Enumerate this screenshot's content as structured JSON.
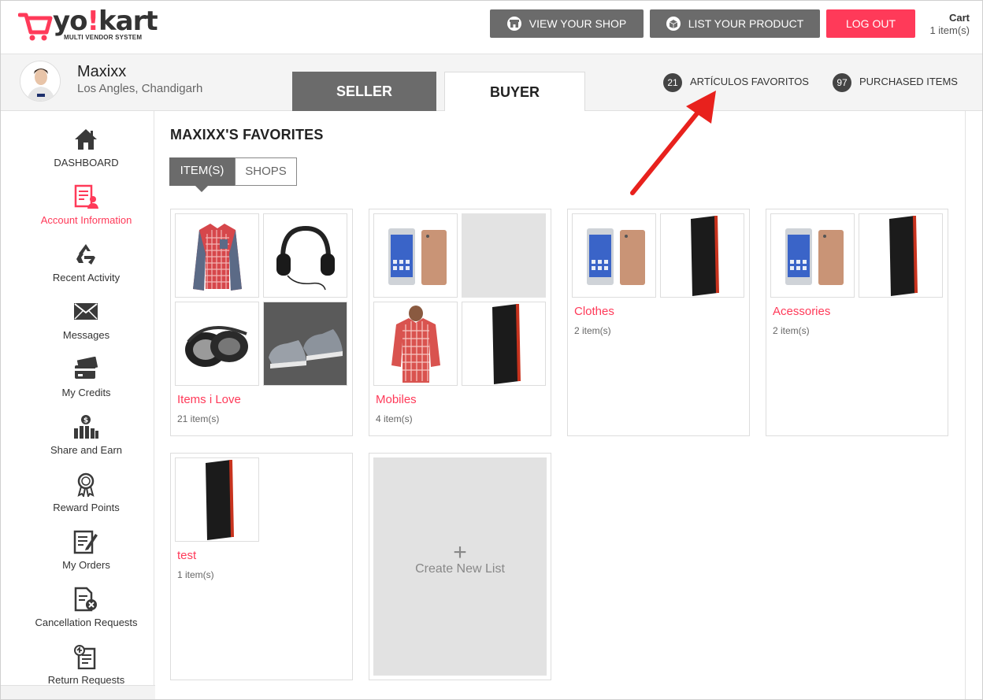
{
  "header": {
    "logo_main": "yo",
    "logo_mark": "!",
    "logo_end": "kart",
    "logo_sub": "MULTI VENDOR SYSTEM",
    "view_shop": "VIEW YOUR SHOP",
    "list_product": "LIST YOUR PRODUCT",
    "logout": "LOG OUT",
    "cart_title": "Cart",
    "cart_count": "1 item(s)"
  },
  "profile": {
    "name": "Maxixx",
    "location": "Los Angles, Chandigarh",
    "tabs": [
      "SELLER",
      "BUYER"
    ],
    "fav_count": "21",
    "fav_label": "ARTÍCULOS FAVORITOS",
    "purchased_count": "97",
    "purchased_label": "PURCHASED ITEMS"
  },
  "sidebar": {
    "items": [
      {
        "label": "DASHBOARD",
        "icon": "home-icon"
      },
      {
        "label": "Account Information",
        "icon": "account-icon"
      },
      {
        "label": "Recent Activity",
        "icon": "recycle-icon"
      },
      {
        "label": "Messages",
        "icon": "envelope-icon"
      },
      {
        "label": "My Credits",
        "icon": "credit-card-icon"
      },
      {
        "label": "Share and Earn",
        "icon": "share-earn-icon"
      },
      {
        "label": "Reward Points",
        "icon": "award-icon"
      },
      {
        "label": "My Orders",
        "icon": "orders-icon"
      },
      {
        "label": "Cancellation Requests",
        "icon": "cancel-doc-icon"
      },
      {
        "label": "Return Requests",
        "icon": "return-doc-icon"
      }
    ]
  },
  "main": {
    "title": "MAXIXX'S FAVORITES",
    "seg": [
      "ITEM(S)",
      "SHOPS"
    ],
    "lists": [
      {
        "name": "Items i Love",
        "count": "21 item(s)"
      },
      {
        "name": "Mobiles",
        "count": "4 item(s)"
      },
      {
        "name": "Clothes",
        "count": "2 item(s)"
      },
      {
        "name": "Acessories",
        "count": "2 item(s)"
      },
      {
        "name": "test",
        "count": "1 item(s)"
      }
    ],
    "new_list": "Create New List"
  },
  "colors": {
    "accent": "#ff3a59",
    "dark": "#6b6b6b"
  }
}
